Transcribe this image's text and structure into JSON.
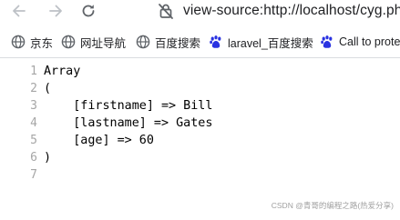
{
  "toolbar": {
    "url": "view-source:http://localhost/cyg.php"
  },
  "bookmarks": [
    {
      "label": "京东",
      "icon": "globe-icon"
    },
    {
      "label": "网址导航",
      "icon": "globe-icon"
    },
    {
      "label": "百度搜索",
      "icon": "globe-icon"
    },
    {
      "label": "laravel_百度搜索",
      "icon": "baidu-paw-icon"
    },
    {
      "label": "Call to prote",
      "icon": "baidu-paw-icon"
    }
  ],
  "source_lines": [
    {
      "num": "1",
      "text": "Array"
    },
    {
      "num": "2",
      "text": "("
    },
    {
      "num": "3",
      "text": "    [firstname] => Bill"
    },
    {
      "num": "4",
      "text": "    [lastname] => Gates"
    },
    {
      "num": "5",
      "text": "    [age] => 60"
    },
    {
      "num": "6",
      "text": ")"
    },
    {
      "num": "7",
      "text": ""
    }
  ],
  "watermark": "CSDN @青哥的编程之路(热爱分享)",
  "colors": {
    "baidu_blue": "#2932e1",
    "line_number_gray": "#a6a6a6"
  }
}
